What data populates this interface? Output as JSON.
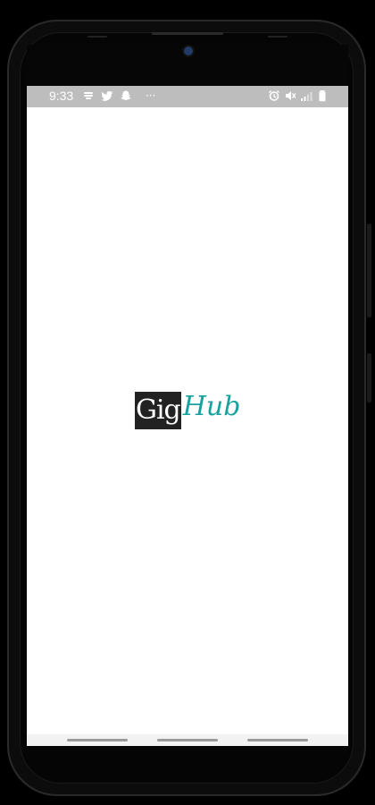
{
  "status_bar": {
    "time": "9:33",
    "left_icons": [
      "notification-icon",
      "twitter-icon",
      "snapchat-icon",
      "more-dots-icon"
    ],
    "right_icons": [
      "alarm-icon",
      "mute-icon",
      "signal-icon",
      "battery-icon"
    ],
    "more_label": "···"
  },
  "logo": {
    "part1": "Gig",
    "part2": "Hub"
  },
  "colors": {
    "status_bar_bg": "#bdbdbd",
    "logo_dark_bg": "#222222",
    "logo_accent": "#17a2a0",
    "screen_bg": "#ffffff"
  }
}
